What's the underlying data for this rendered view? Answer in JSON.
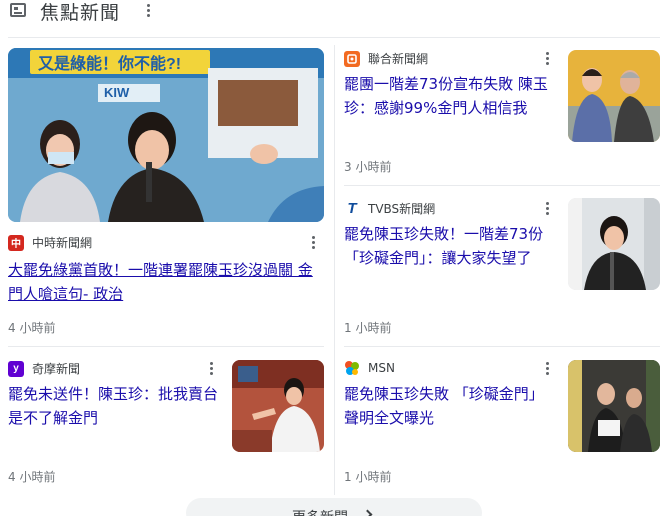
{
  "header": {
    "title": "焦點新聞",
    "icon": "news-icon"
  },
  "cards": [
    {
      "source": "中時新聞網",
      "logo_icon": "chinatimes-logo-icon",
      "logo_color": "#d4281f",
      "logo_char": "中",
      "headline": "大罷免綠黨首敗！一階連署罷陳玉珍沒過關 金門人嗆這句- 政治",
      "time": "4 小時前",
      "image_banner": "又是綠能！你不能?!",
      "image_sign": "KIW"
    },
    {
      "source": "聯合新聞網",
      "logo_icon": "udn-logo-icon",
      "logo_color": "#f26a21",
      "headline": "罷團一階差73份宣布失敗 陳玉珍：感謝99%金門人相信我",
      "time": "3 小時前"
    },
    {
      "source": "TVBS新聞網",
      "logo_icon": "tvbs-logo-icon",
      "logo_color": "#0f4c9c",
      "logo_char": "T",
      "headline": "罷免陳玉珍失敗！一階差73份「珍礙金門」：讓大家失望了",
      "time": "1 小時前"
    },
    {
      "source": "奇摩新聞",
      "logo_icon": "yahoo-logo-icon",
      "logo_color": "#6001d2",
      "logo_char": "y",
      "headline": "罷免未送件！陳玉珍：批我賣台是不了解金門",
      "time": "4 小時前"
    },
    {
      "source": "MSN",
      "logo_icon": "msn-logo-icon",
      "logo_color": "#0078d4",
      "headline": "罷免陳玉珍失敗 「珍礙金門」聲明全文曝光",
      "time": "1 小時前"
    }
  ],
  "more_button": {
    "label": "更多新聞"
  }
}
